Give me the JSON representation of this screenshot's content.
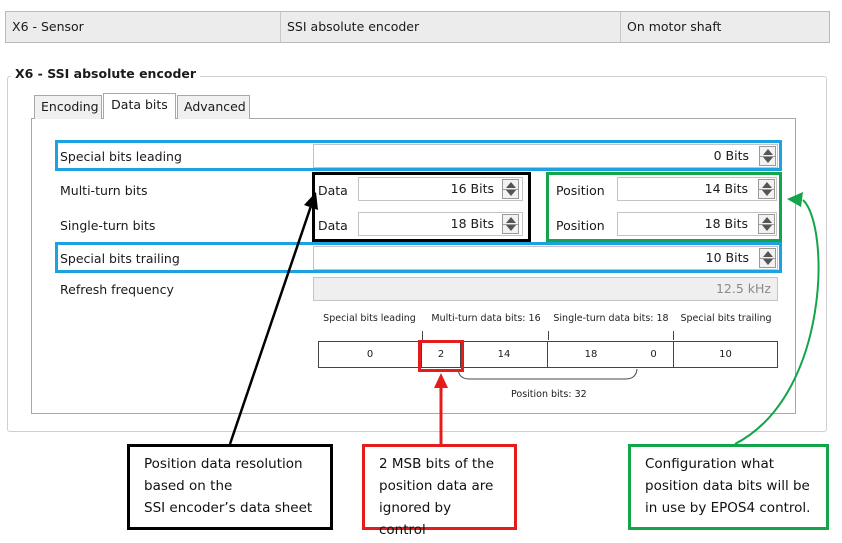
{
  "header": {
    "connector": "X6 - Sensor",
    "sensor_type": "SSI absolute encoder",
    "mounting": "On motor shaft"
  },
  "group": {
    "title": "X6 - SSI absolute encoder"
  },
  "tabs": [
    {
      "label": "Encoding",
      "active": false
    },
    {
      "label": "Data bits",
      "active": true
    },
    {
      "label": "Advanced",
      "active": false
    }
  ],
  "rows": {
    "special_leading": {
      "label": "Special bits leading",
      "value": "0 Bits"
    },
    "multi_turn": {
      "label": "Multi-turn bits",
      "data_label": "Data",
      "data_value": "16 Bits",
      "pos_label": "Position",
      "pos_value": "14 Bits"
    },
    "single_turn": {
      "label": "Single-turn bits",
      "data_label": "Data",
      "data_value": "18 Bits",
      "pos_label": "Position",
      "pos_value": "18 Bits"
    },
    "special_trailing": {
      "label": "Special bits trailing",
      "value": "10 Bits"
    },
    "refresh": {
      "label": "Refresh frequency",
      "value": "12.5 kHz"
    }
  },
  "diagram": {
    "headers": {
      "leading": "Special bits leading",
      "multi": "Multi-turn data bits: 16",
      "single": "Single-turn data bits: 18",
      "trailing": "Special bits trailing"
    },
    "cells": {
      "leading": "0",
      "msb": "2",
      "multi": "14",
      "single": "18",
      "gap": "0",
      "trailing": "10"
    },
    "position_bits": "Position bits: 32"
  },
  "callouts": {
    "black": [
      "Position data resolution",
      "based on the",
      "SSI encoder’s data sheet"
    ],
    "red": [
      "2 MSB bits of the",
      "position data are",
      "ignored by control"
    ],
    "green": [
      "Configuration what",
      "position data bits will be",
      "in use by EPOS4 control."
    ]
  },
  "colors": {
    "blue": "#1aa3e0",
    "black": "#000000",
    "green": "#14a54a",
    "red": "#e41c1c"
  }
}
